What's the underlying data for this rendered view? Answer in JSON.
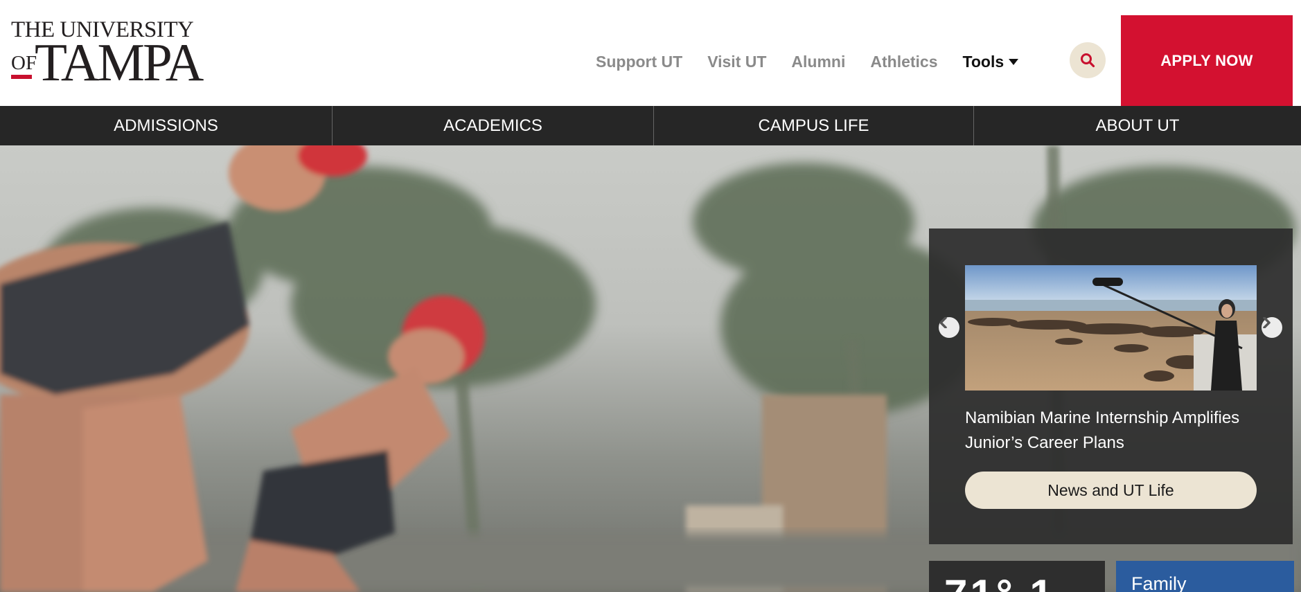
{
  "header": {
    "logo": {
      "line1": "THE UNIVERSITY",
      "of": "OF",
      "main": "TAMPA"
    },
    "utility_links": [
      "Support UT",
      "Visit UT",
      "Alumni",
      "Athletics"
    ],
    "tools_label": "Tools",
    "search_icon": "search-icon",
    "apply_label": "APPLY NOW"
  },
  "main_nav": [
    "ADMISSIONS",
    "ACADEMICS",
    "CAMPUS LIFE",
    "ABOUT UT"
  ],
  "news": {
    "title": "Namibian Marine Internship Amplifies Junior’s Career Plans",
    "button_label": "News and UT Life",
    "prev_icon": "chevron-left-icon",
    "next_icon": "chevron-right-icon"
  },
  "widgets": {
    "weather_partial": "71° 1",
    "family_label": "Family"
  },
  "colors": {
    "brand_red": "#d31130",
    "nav_dark": "#262626",
    "cream": "#ece4d3",
    "utility_gray": "#8a8a8a"
  }
}
